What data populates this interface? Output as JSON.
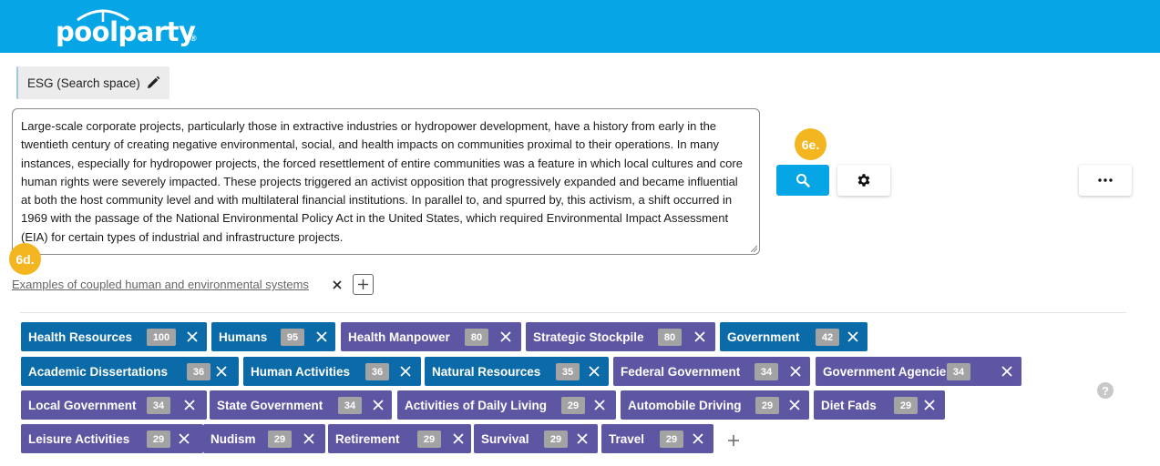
{
  "brand": {
    "name": "poolparty",
    "mark": "®"
  },
  "search_space": {
    "label": "ESG (Search space)"
  },
  "query": {
    "text": "Large-scale corporate projects, particularly those in extractive industries or hydropower development, have a history from early in the twentieth century of creating negative environmental, social, and health impacts on communities proximal to their operations. In many instances, especially for hydropower projects, the forced resettlement of entire communities was a feature in which local cultures and core human rights were severely impacted. These projects triggered an activist opposition that progressively expanded and became influential at both the host community level and with multilateral financial institutions. In parallel to, and spurred by, this activism, a shift occurred in 1969 with the passage of the National Environmental Policy Act in the United States, which required Environmental Impact Assessment (EIA) for certain types of industrial and infrastructure projects."
  },
  "annotations": {
    "badge_search": "6e.",
    "badge_examples": "6d."
  },
  "examples": {
    "link_text": "Examples of coupled human and environmental systems"
  },
  "help": {
    "glyph": "?"
  },
  "colors": {
    "header": "#06a6e6",
    "tag_blue": "#0b6aa8",
    "tag_purple": "#5c56a3",
    "badge": "#f3b621"
  },
  "tags": [
    {
      "label": "Health Resources",
      "count": "100",
      "color": "blue"
    },
    {
      "label": "Humans",
      "count": "95",
      "color": "blue"
    },
    {
      "label": "Health Manpower",
      "count": "80",
      "color": "purple"
    },
    {
      "label": "Strategic Stockpile",
      "count": "80",
      "color": "purple"
    },
    {
      "label": "Government",
      "count": "42",
      "color": "blue"
    },
    {
      "label": "Academic Dissertations",
      "count": "36",
      "color": "blue"
    },
    {
      "label": "Human Activities",
      "count": "36",
      "color": "blue"
    },
    {
      "label": "Natural Resources",
      "count": "35",
      "color": "blue"
    },
    {
      "label": "Federal Government",
      "count": "34",
      "color": "purple"
    },
    {
      "label": "Government Agencies",
      "count": "34",
      "color": "purple"
    },
    {
      "label": "Local Government",
      "count": "34",
      "color": "purple"
    },
    {
      "label": "State Government",
      "count": "34",
      "color": "purple"
    },
    {
      "label": "Activities of Daily Living",
      "count": "29",
      "color": "purple"
    },
    {
      "label": "Automobile Driving",
      "count": "29",
      "color": "purple"
    },
    {
      "label": "Diet Fads",
      "count": "29",
      "color": "purple"
    },
    {
      "label": "Leisure Activities",
      "count": "29",
      "color": "purple"
    },
    {
      "label": "Nudism",
      "count": "29",
      "color": "purple"
    },
    {
      "label": "Retirement",
      "count": "29",
      "color": "purple"
    },
    {
      "label": "Survival",
      "count": "29",
      "color": "purple"
    },
    {
      "label": "Travel",
      "count": "29",
      "color": "purple"
    }
  ]
}
